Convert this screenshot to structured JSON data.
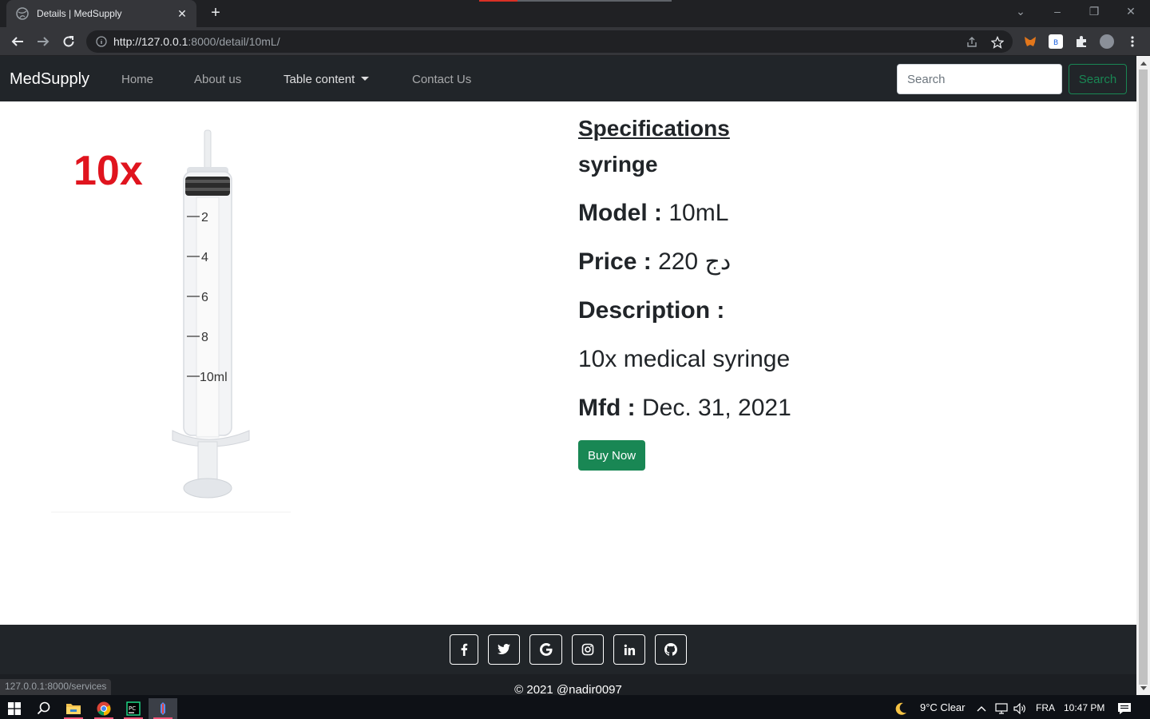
{
  "browser": {
    "tab_title": "Details | MedSupply",
    "url_host": "http://127.0.0.1",
    "url_rest": ":8000/detail/10mL/",
    "status_url": "127.0.0.1:8000/services"
  },
  "navbar": {
    "brand": "MedSupply",
    "links": [
      "Home",
      "About us",
      "Table content",
      "Contact Us"
    ],
    "search_placeholder": "Search",
    "search_button": "Search"
  },
  "product": {
    "image_badge": "10x",
    "scale_marks": [
      "2",
      "4",
      "6",
      "8",
      "10ml"
    ],
    "heading": "Specifications",
    "name": "syringe",
    "model_label": "Model :",
    "model_value": "10mL",
    "price_label": "Price :",
    "price_value": "220 دج",
    "description_label": "Description :",
    "description_value": "10x medical syringe",
    "mfd_label": "Mfd :",
    "mfd_value": "Dec. 31, 2021",
    "buy_button": "Buy Now"
  },
  "footer": {
    "social_icons": [
      "facebook-icon",
      "twitter-icon",
      "google-icon",
      "instagram-icon",
      "linkedin-icon",
      "github-icon"
    ],
    "copyright": "© 2021 @nadir0097"
  },
  "taskbar": {
    "weather": "9°C  Clear",
    "language": "FRA",
    "time": "10:47 PM"
  },
  "colors": {
    "navbar_bg": "#212529",
    "success": "#198754",
    "badge_red": "#e0141e"
  }
}
